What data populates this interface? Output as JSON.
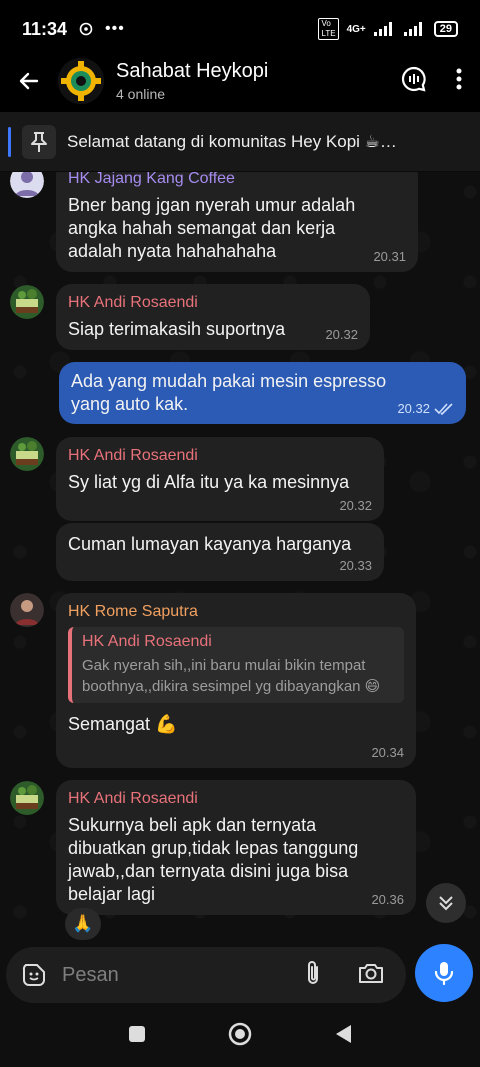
{
  "status": {
    "time": "11:34",
    "network": "4G+",
    "battery": "29"
  },
  "header": {
    "title": "Sahabat Heykopi",
    "subtitle": "4 online"
  },
  "pinned": {
    "text": "Selamat datang di komunitas Hey Kopi ☕…"
  },
  "messages": [
    {
      "sender": "HK Jajang Kang Coffee",
      "text": "Bner bang jgan nyerah umur adalah angka hahah semangat dan kerja adalah nyata hahahahaha",
      "time": "20.31"
    },
    {
      "sender": "HK Andi Rosaendi",
      "text": "Siap terimakasih suportnya",
      "time": "20.32"
    },
    {
      "text": "Ada yang mudah pakai mesin espresso yang auto kak.",
      "time": "20.32"
    },
    {
      "sender": "HK Andi Rosaendi",
      "text": "Sy liat yg di Alfa itu ya ka mesinnya",
      "time": "20.32"
    },
    {
      "text": "Cuman lumayan kayanya harganya",
      "time": "20.33"
    },
    {
      "sender": "HK Rome Saputra",
      "quote_name": "HK Andi Rosaendi",
      "quote_text": "Gak nyerah sih,,ini baru mulai bikin tempat boothnya,,dikira sesimpel yg dibayangkan 😄",
      "text": "Semangat 💪",
      "time": "20.34"
    },
    {
      "sender": "HK Andi Rosaendi",
      "text": "Sukurnya beli apk dan ternyata dibuatkan grup,tidak lepas tanggung jawab,,dan ternyata disini juga bisa belajar lagi",
      "time": "20.36",
      "reaction": "🙏"
    }
  ],
  "input": {
    "placeholder": "Pesan"
  },
  "colors": {
    "accent": "#2d83ff",
    "outgoing_bubble": "#2b5bb5",
    "incoming_bubble": "#212121",
    "name_purple": "#a68cf0",
    "name_red": "#e8727a",
    "name_orange": "#f0a060"
  },
  "icons": [
    "back-arrow-icon",
    "voice-chat-icon",
    "more-vert-icon",
    "pin-icon",
    "sticker-icon",
    "attach-icon",
    "camera-icon",
    "mic-icon",
    "chevron-down-icon",
    "double-check-icon"
  ]
}
